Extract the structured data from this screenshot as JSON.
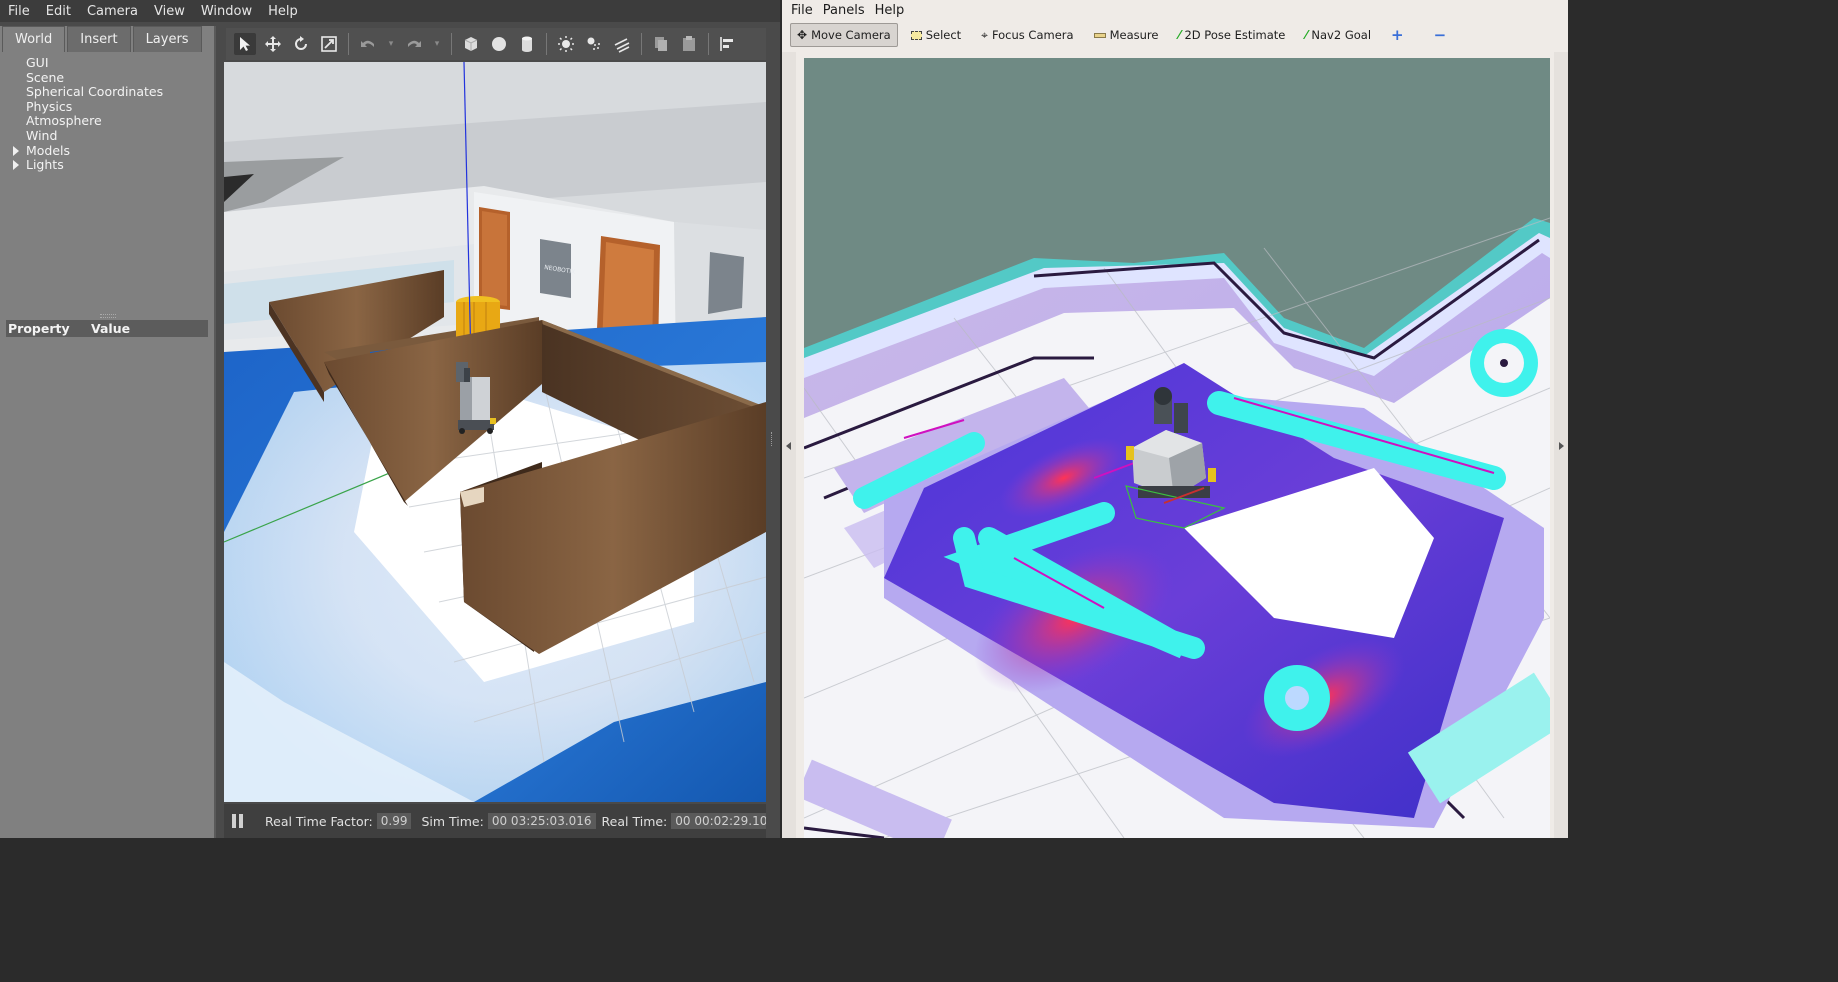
{
  "gazebo": {
    "menu": [
      "File",
      "Edit",
      "Camera",
      "View",
      "Window",
      "Help"
    ],
    "tabs": [
      "World",
      "Insert",
      "Layers"
    ],
    "tree": [
      "GUI",
      "Scene",
      "Spherical Coordinates",
      "Physics",
      "Atmosphere",
      "Wind",
      "Models",
      "Lights"
    ],
    "property_header": {
      "property": "Property",
      "value": "Value"
    },
    "toolbar_icons": [
      "select-mode-icon",
      "translate-icon",
      "rotate-icon",
      "scale-icon",
      "undo-icon",
      "undo-dropdown-icon",
      "redo-icon",
      "redo-dropdown-icon",
      "box-icon",
      "sphere-icon",
      "cylinder-icon",
      "point-light-icon",
      "spot-light-icon",
      "directional-light-icon",
      "copy-icon",
      "paste-icon",
      "align-icon"
    ],
    "status": {
      "real_time_factor_label": "Real Time Factor:",
      "real_time_factor": "0.99",
      "sim_time_label": "Sim Time:",
      "sim_time": "00 03:25:03.016",
      "real_time_label": "Real Time:",
      "real_time": "00 00:02:29.10"
    },
    "scene": {
      "wall_logo": "NEOBOTIX"
    }
  },
  "rviz": {
    "menu": [
      "File",
      "Panels",
      "Help"
    ],
    "tools": [
      {
        "label": "Move Camera",
        "icon": "move-camera-icon",
        "active": true
      },
      {
        "label": "Select",
        "icon": "select-icon",
        "active": false
      },
      {
        "label": "Focus Camera",
        "icon": "focus-camera-icon",
        "active": false
      },
      {
        "label": "Measure",
        "icon": "measure-icon",
        "active": false
      },
      {
        "label": "2D Pose Estimate",
        "icon": "pose-estimate-icon",
        "active": false
      },
      {
        "label": "Nav2 Goal",
        "icon": "nav-goal-icon",
        "active": false
      }
    ],
    "extra_icons": [
      "add-tool-icon",
      "remove-tool-icon"
    ],
    "colors": {
      "background": "#6f8a84",
      "costmap_cyan": "#3ff2ec",
      "costmap_blue": "#4338d6",
      "inflation_red": "#ff2a4a"
    }
  }
}
